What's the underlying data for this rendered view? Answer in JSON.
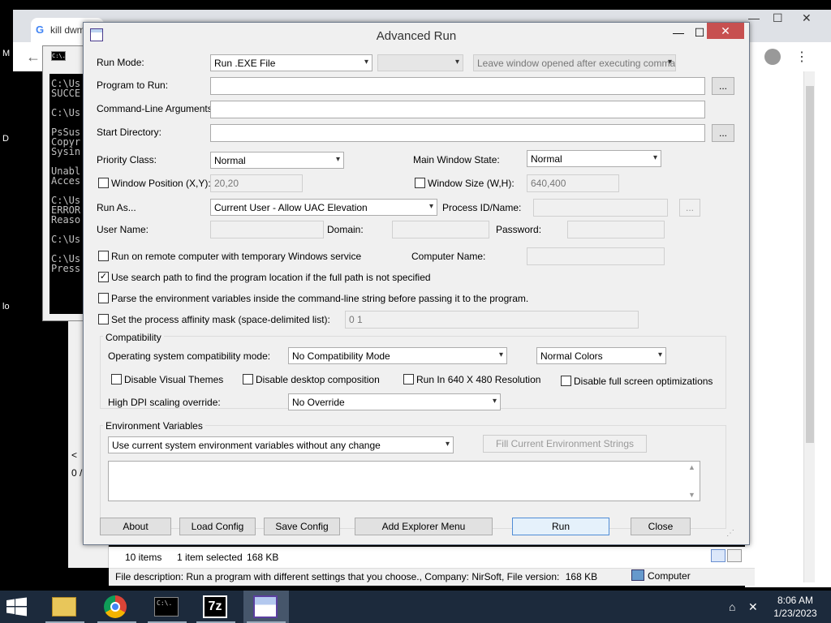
{
  "browser": {
    "tab_title": "kill dwm",
    "back_icon": "←",
    "min": "—",
    "max": "☐",
    "close": "✕",
    "more": "⋮"
  },
  "cmd": {
    "icon_text": "C:\\.",
    "lines": "C:\\Us\nSUCCE\n\nC:\\Us\n\nPsSus\nCopyr\nSysin\n\nUnabl\nAcces\n\nC:\\Us\nERROR\nReaso\n\nC:\\Us\n\nC:\\Us\nPress"
  },
  "left_fragment": {
    "scroll_arrow": "<",
    "row": "0 /"
  },
  "desktop_letters": {
    "m": "M",
    "d": "D",
    "lo": "lo"
  },
  "explorer_status": {
    "items": "10 items",
    "selected": "1 item selected",
    "size": "168 KB",
    "description": "File description: Run a program with different settings that you choose., Company: NirSoft, File version:",
    "desc_size": "168 KB",
    "computer": "Computer"
  },
  "dialog": {
    "title": "Advanced Run",
    "min": "—",
    "max": "☐",
    "close": "✕"
  },
  "form": {
    "run_mode_label": "Run Mode:",
    "run_mode_value": "Run .EXE File",
    "leave_window": "Leave window opened after executing command",
    "program_label": "Program to Run:",
    "program_value": "",
    "args_label": "Command-Line Arguments:",
    "args_value": "",
    "start_dir_label": "Start Directory:",
    "start_dir_value": "",
    "browse": "...",
    "priority_label": "Priority Class:",
    "priority_value": "Normal",
    "main_window_label": "Main Window State:",
    "main_window_value": "Normal",
    "window_pos_label": "Window Position (X,Y):",
    "window_pos_value": "20,20",
    "window_size_label": "Window Size (W,H):",
    "window_size_value": "640,400",
    "run_as_label": "Run As...",
    "run_as_value": "Current User - Allow UAC Elevation",
    "process_label": "Process ID/Name:",
    "user_label": "User Name:",
    "domain_label": "Domain:",
    "password_label": "Password:",
    "remote_label": "Run on remote computer with temporary Windows service",
    "computer_name_label": "Computer Name:",
    "search_path_label": "Use search path to find the program location if the full path is not specified",
    "parse_env_label": "Parse the environment variables inside the command-line string before passing it to the program.",
    "affinity_label": "Set the process affinity mask (space-delimited list):",
    "affinity_value": "0 1",
    "check_mark": "✓",
    "dropdown_arrow": "▾"
  },
  "compat": {
    "title": "Compatibility",
    "os_label": "Operating system compatibility mode:",
    "os_value": "No Compatibility Mode",
    "colors_value": "Normal Colors",
    "visual_themes": "Disable Visual Themes",
    "desktop_comp": "Disable desktop composition",
    "run640": "Run In 640 X 480 Resolution",
    "fullscreen": "Disable full screen optimizations",
    "dpi_label": "High DPI scaling override:",
    "dpi_value": "No Override"
  },
  "env": {
    "title": "Environment Variables",
    "mode_value": "Use current system environment variables without any change",
    "fill_button": "Fill Current Environment Strings",
    "scroll_up": "▲",
    "scroll_down": "▼"
  },
  "buttons": {
    "about": "About",
    "load": "Load Config",
    "save": "Save Config",
    "explorer": "Add Explorer Menu",
    "run": "Run",
    "close": "Close"
  },
  "taskbar": {
    "time": "8:06 AM",
    "date": "1/23/2023",
    "cmd_icon": "C:\\.",
    "sevenzip": "7z"
  }
}
